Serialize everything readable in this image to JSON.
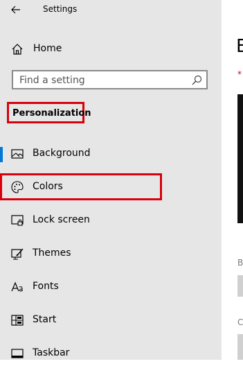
{
  "window": {
    "title": "Settings"
  },
  "nav": {
    "home_label": "Home"
  },
  "search": {
    "placeholder": "Find a setting"
  },
  "section": {
    "title": "Personalization"
  },
  "sidebar": {
    "items": [
      {
        "label": "Background",
        "icon": "image-icon"
      },
      {
        "label": "Colors",
        "icon": "palette-icon"
      },
      {
        "label": "Lock screen",
        "icon": "lock-screen-icon"
      },
      {
        "label": "Themes",
        "icon": "themes-icon"
      },
      {
        "label": "Fonts",
        "icon": "fonts-icon"
      },
      {
        "label": "Start",
        "icon": "start-icon"
      },
      {
        "label": "Taskbar",
        "icon": "taskbar-icon"
      }
    ]
  },
  "main": {
    "heading": "B",
    "required_marker": "*",
    "sub_label_1": "B",
    "sub_label_2": "C"
  },
  "colors": {
    "sidebar_bg": "#e6e6e6",
    "accent": "#0078d7",
    "highlight": "#d8000c"
  }
}
